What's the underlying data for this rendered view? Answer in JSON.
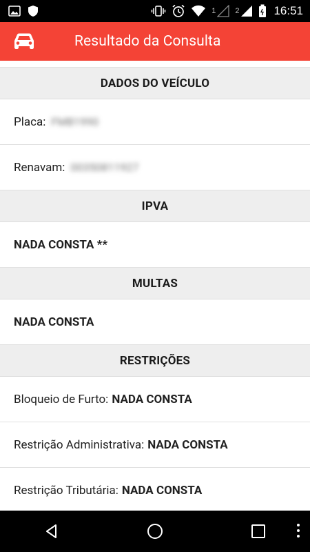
{
  "status_bar": {
    "sim1": "1",
    "sim2": "2",
    "time": "16:51"
  },
  "app_bar": {
    "title": "Resultado da Consulta",
    "icon": "car-icon"
  },
  "sections": {
    "dados": {
      "header": "DADOS DO VEÍCULO",
      "placa_label": "Placa:",
      "placa_value": "FMB1990",
      "renavam_label": "Renavam:",
      "renavam_value": "00350811927"
    },
    "ipva": {
      "header": "IPVA",
      "status": "NADA CONSTA **"
    },
    "multas": {
      "header": "MULTAS",
      "status": "NADA CONSTA"
    },
    "restricoes": {
      "header": "RESTRIÇÕES",
      "items": [
        {
          "label": "Bloqueio de Furto:",
          "value": "NADA CONSTA"
        },
        {
          "label": "Restrição Administrativa:",
          "value": "NADA CONSTA"
        },
        {
          "label": "Restrição Tributária:",
          "value": "NADA CONSTA"
        }
      ]
    }
  },
  "colors": {
    "app_bar": "#f44336",
    "section_header_bg": "#eeeeee",
    "status_bar": "#000000",
    "nav_bar": "#000000"
  },
  "nav_bar": {
    "icons": [
      "back-icon",
      "home-icon",
      "recents-icon",
      "more-icon"
    ]
  }
}
